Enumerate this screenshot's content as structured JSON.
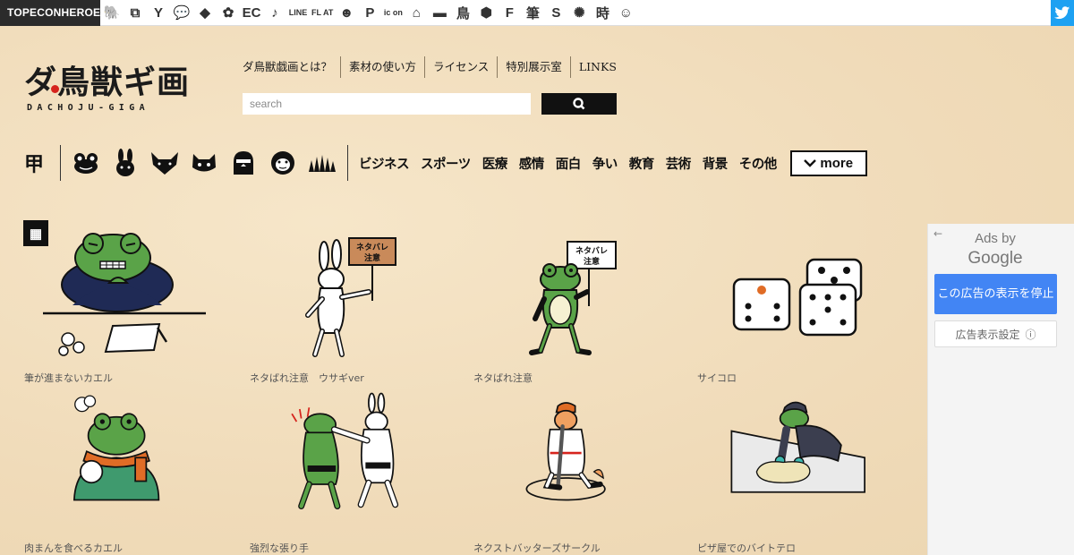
{
  "topbar": {
    "brand": "TOPECONHEROES",
    "icons": [
      {
        "name": "animal-icon",
        "glyph": "🐘"
      },
      {
        "name": "copy-icon",
        "glyph": "⧉"
      },
      {
        "name": "person-icon",
        "glyph": "Y"
      },
      {
        "name": "speech-bubble-icon",
        "glyph": "💬"
      },
      {
        "name": "tag-icon",
        "glyph": "◆"
      },
      {
        "name": "flower-icon",
        "glyph": "✿"
      },
      {
        "name": "ec-icon",
        "glyph": "EC"
      },
      {
        "name": "music-note-icon",
        "glyph": "♪"
      },
      {
        "name": "line-icon",
        "glyph": "LINE"
      },
      {
        "name": "flat-icon",
        "glyph": "FL AT"
      },
      {
        "name": "smiley-icon",
        "glyph": "☻"
      },
      {
        "name": "parking-icon",
        "glyph": "P"
      },
      {
        "name": "icon-icon",
        "glyph": "ic on"
      },
      {
        "name": "building-icon",
        "glyph": "⌂"
      },
      {
        "name": "bed-icon",
        "glyph": "▬"
      },
      {
        "name": "bird-kanji-icon",
        "glyph": "鳥"
      },
      {
        "name": "hexagon-icon",
        "glyph": "⬢"
      },
      {
        "name": "font-f-icon",
        "glyph": "F"
      },
      {
        "name": "brush-kanji-icon",
        "glyph": "筆"
      },
      {
        "name": "s-icon",
        "glyph": "S"
      },
      {
        "name": "grid-icon",
        "glyph": "▦"
      },
      {
        "name": "sparkle-icon",
        "glyph": "✺"
      },
      {
        "name": "time-kanji-icon",
        "glyph": "時"
      },
      {
        "name": "face-icon",
        "glyph": "☺"
      }
    ],
    "twitter": "twitter-icon"
  },
  "logo": {
    "title": "ダ鳥獣ギ画",
    "subtitle": "DACHOJU-GIGA"
  },
  "nav": [
    "ダ鳥獣戯画とは？",
    "素材の使い方",
    "ライセンス",
    "特別展示室",
    "LINKS"
  ],
  "search": {
    "placeholder": "search"
  },
  "categories": {
    "kanji": "甲",
    "animals": [
      "frog",
      "rabbit",
      "fox",
      "cat",
      "bird",
      "monkey",
      "grass"
    ],
    "links": [
      "ビジネス",
      "スポーツ",
      "医療",
      "感情",
      "面白",
      "争い",
      "教育",
      "芸術",
      "背景",
      "その他"
    ],
    "more": "more"
  },
  "items": [
    {
      "caption": "筆が進まないカエル",
      "art": "frog-writer"
    },
    {
      "caption": "ネタばれ注意　ウサギver",
      "art": "rabbit-sign"
    },
    {
      "caption": "ネタばれ注意",
      "art": "frog-sign"
    },
    {
      "caption": "サイコロ",
      "art": "dice"
    },
    {
      "caption": "肉まんを食べるカエル",
      "art": "frog-bun"
    },
    {
      "caption": "強烈な張り手",
      "art": "sumo-slap"
    },
    {
      "caption": "ネクストバッターズサークル",
      "art": "batter"
    },
    {
      "caption": "ピザ屋でのバイトテロ",
      "art": "pizza-frog"
    }
  ],
  "sign_text": {
    "line1": "ネタバレ",
    "line2": "注意"
  },
  "ad": {
    "back": "←",
    "ads_by": "Ads by",
    "google": "Google",
    "stop": "この広告の表示を停止",
    "settings": "広告表示設定",
    "info": "ⓘ"
  },
  "colors": {
    "background": "#f2dfc0",
    "frog_green": "#5aa348",
    "ad_blue": "#4285f4",
    "logo_red": "#d6241d"
  }
}
